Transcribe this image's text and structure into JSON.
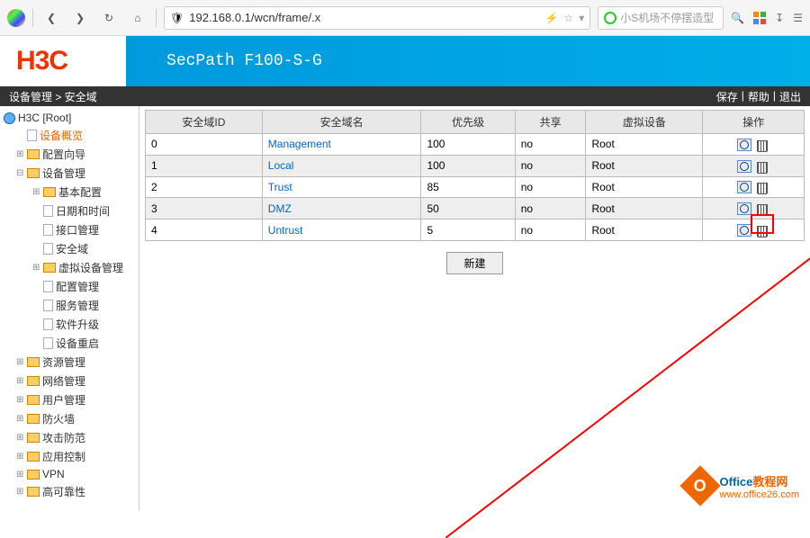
{
  "browser": {
    "url": "192.168.0.1/wcn/frame/.x",
    "search_placeholder": "小S机场不停摆造型"
  },
  "header": {
    "logo": "H3C",
    "product": "SecPath F100-S-G"
  },
  "breadcrumb": {
    "path": "设备管理 > 安全域",
    "actions": {
      "save": "保存",
      "help": "帮助",
      "exit": "退出"
    }
  },
  "tree": {
    "root": "H3C [Root]",
    "items": [
      {
        "label": "设备概览",
        "lv": 1,
        "active": true,
        "icon": "page"
      },
      {
        "label": "配置向导",
        "lv": 1,
        "exp": "+",
        "icon": "folder"
      },
      {
        "label": "设备管理",
        "lv": 1,
        "exp": "-",
        "icon": "folder"
      },
      {
        "label": "基本配置",
        "lv": 2,
        "exp": "+",
        "icon": "folder"
      },
      {
        "label": "日期和时间",
        "lv": 2,
        "icon": "page"
      },
      {
        "label": "接口管理",
        "lv": 2,
        "icon": "page"
      },
      {
        "label": "安全域",
        "lv": 2,
        "icon": "page"
      },
      {
        "label": "虚拟设备管理",
        "lv": 2,
        "exp": "+",
        "icon": "folder"
      },
      {
        "label": "配置管理",
        "lv": 2,
        "icon": "page"
      },
      {
        "label": "服务管理",
        "lv": 2,
        "icon": "page"
      },
      {
        "label": "软件升级",
        "lv": 2,
        "icon": "page"
      },
      {
        "label": "设备重启",
        "lv": 2,
        "icon": "page"
      },
      {
        "label": "资源管理",
        "lv": 1,
        "exp": "+",
        "icon": "folder"
      },
      {
        "label": "网络管理",
        "lv": 1,
        "exp": "+",
        "icon": "folder"
      },
      {
        "label": "用户管理",
        "lv": 1,
        "exp": "+",
        "icon": "folder"
      },
      {
        "label": "防火墙",
        "lv": 1,
        "exp": "+",
        "icon": "folder"
      },
      {
        "label": "攻击防范",
        "lv": 1,
        "exp": "+",
        "icon": "folder"
      },
      {
        "label": "应用控制",
        "lv": 1,
        "exp": "+",
        "icon": "folder"
      },
      {
        "label": "VPN",
        "lv": 1,
        "exp": "+",
        "icon": "folder"
      },
      {
        "label": "高可靠性",
        "lv": 1,
        "exp": "+",
        "icon": "folder"
      }
    ]
  },
  "table": {
    "headers": [
      "安全域ID",
      "安全域名",
      "优先级",
      "共享",
      "虚拟设备",
      "操作"
    ],
    "rows": [
      {
        "id": "0",
        "name": "Management",
        "priority": "100",
        "share": "no",
        "device": "Root"
      },
      {
        "id": "1",
        "name": "Local",
        "priority": "100",
        "share": "no",
        "device": "Root"
      },
      {
        "id": "2",
        "name": "Trust",
        "priority": "85",
        "share": "no",
        "device": "Root"
      },
      {
        "id": "3",
        "name": "DMZ",
        "priority": "50",
        "share": "no",
        "device": "Root"
      },
      {
        "id": "4",
        "name": "Untrust",
        "priority": "5",
        "share": "no",
        "device": "Root"
      }
    ],
    "new_button": "新建"
  },
  "watermark": {
    "title_a": "Office",
    "title_b": "教程网",
    "url": "www.office26.com"
  }
}
